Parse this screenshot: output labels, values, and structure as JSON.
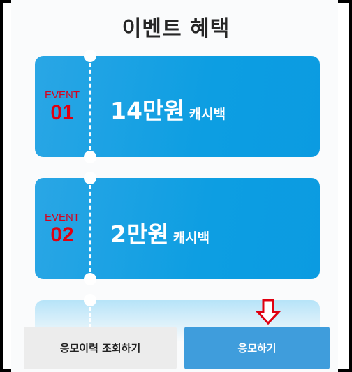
{
  "title": "이벤트 혜택",
  "events": [
    {
      "label": "EVENT",
      "number": "01",
      "amount": "14만원",
      "suffix": "캐시백"
    },
    {
      "label": "EVENT",
      "number": "02",
      "amount": "2만원",
      "suffix": "캐시백"
    }
  ],
  "buttons": {
    "history": "응모이력 조회하기",
    "apply": "응모하기"
  },
  "colors": {
    "ticket": "#0d9ee2",
    "event_red": "#e00010",
    "apply_button": "#3f9ddc",
    "arrow": "#e00010"
  },
  "icons": {
    "annotation": "down-arrow-icon"
  }
}
